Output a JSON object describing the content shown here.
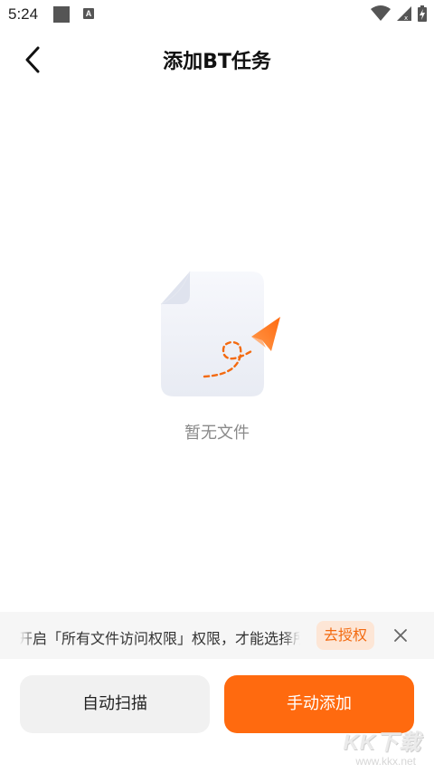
{
  "status_bar": {
    "time": "5:24",
    "icons": [
      "notification-square-icon",
      "a-icon",
      "wifi-icon",
      "signal-icon",
      "battery-icon"
    ]
  },
  "header": {
    "title": "添加BT任务",
    "back_icon": "chevron-left-icon"
  },
  "empty_state": {
    "illustration": "paper-plane-file-icon",
    "text": "暂无文件"
  },
  "permission_banner": {
    "text": "开启「所有文件访问权限」权限，才能选择所有",
    "authorize_label": "去授权",
    "close_icon": "close-icon"
  },
  "bottom_actions": {
    "auto_scan_label": "自动扫描",
    "manual_add_label": "手动添加"
  },
  "watermark": {
    "logo": "KK下载",
    "url": "www.kkx.net"
  },
  "colors": {
    "accent": "#ff6a0f",
    "accent_soft": "#fde6d6",
    "banner_bg": "#f6f6f6",
    "secondary_button_bg": "#f1f1f1",
    "muted_text": "#8a8a8a"
  }
}
